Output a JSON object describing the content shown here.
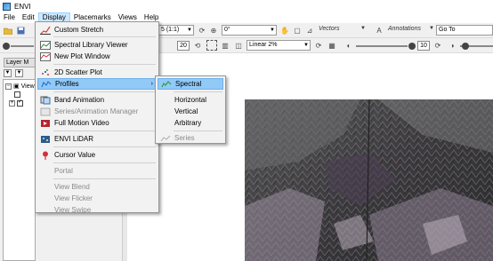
{
  "window": {
    "title": "ENVI"
  },
  "menubar": {
    "items": [
      "File",
      "Edit",
      "Display",
      "Placemarks",
      "Views",
      "Help"
    ],
    "active": "Display"
  },
  "toolbar1": {
    "scale_value": "5 (1:1)",
    "rotation_value": "0°",
    "vectors_label": "Vectors",
    "annotations_label": "Annotations",
    "goto_value": "Go To"
  },
  "toolbar2": {
    "value_20": "20",
    "stretch_value": "Linear 2%",
    "value_10": "10",
    "value_0": "0"
  },
  "layer_panel": {
    "tab_label": "Layer M",
    "tree_root": "View"
  },
  "display_menu": {
    "items": [
      {
        "label": "Custom Stretch",
        "icon": "stretch-icon",
        "disabled": false
      },
      {
        "label": "Spectral Library Viewer",
        "icon": "spectral-library-icon",
        "disabled": false
      },
      {
        "label": "New Plot Window",
        "icon": "plot-window-icon",
        "disabled": false
      },
      {
        "label": "2D Scatter Plot",
        "icon": "scatter-plot-icon",
        "disabled": false
      },
      {
        "label": "Profiles",
        "icon": "profiles-icon",
        "disabled": false,
        "submenu": true
      },
      {
        "label": "Band Animation",
        "icon": "band-animation-icon",
        "disabled": false
      },
      {
        "label": "Series/Animation Manager",
        "icon": "series-manager-icon",
        "disabled": true
      },
      {
        "label": "Full Motion Video",
        "icon": "video-icon",
        "disabled": false
      },
      {
        "label": "ENVI LiDAR",
        "icon": "lidar-icon",
        "disabled": false
      },
      {
        "label": "Cursor Value",
        "icon": "cursor-value-icon",
        "disabled": false
      },
      {
        "label": "Portal",
        "icon": "portal-icon",
        "disabled": true
      },
      {
        "label": "View Blend",
        "icon": "view-blend-icon",
        "disabled": true
      },
      {
        "label": "View Flicker",
        "icon": "view-flicker-icon",
        "disabled": true
      },
      {
        "label": "View Swipe",
        "icon": "view-swipe-icon",
        "disabled": true
      }
    ]
  },
  "profiles_submenu": {
    "items": [
      {
        "label": "Spectral",
        "icon": "spectral-profile-icon",
        "disabled": false
      },
      {
        "label": "Horizontal",
        "icon": "horizontal-profile-icon",
        "disabled": false
      },
      {
        "label": "Vertical",
        "icon": "vertical-profile-icon",
        "disabled": false
      },
      {
        "label": "Arbitrary",
        "icon": "arbitrary-profile-icon",
        "disabled": false
      },
      {
        "label": "Series",
        "icon": "series-profile-icon",
        "disabled": true
      }
    ]
  },
  "colors": {
    "highlight": "#91c9f7",
    "menu_bg": "#f2f2f2",
    "disabled_text": "#8a8a8a"
  }
}
